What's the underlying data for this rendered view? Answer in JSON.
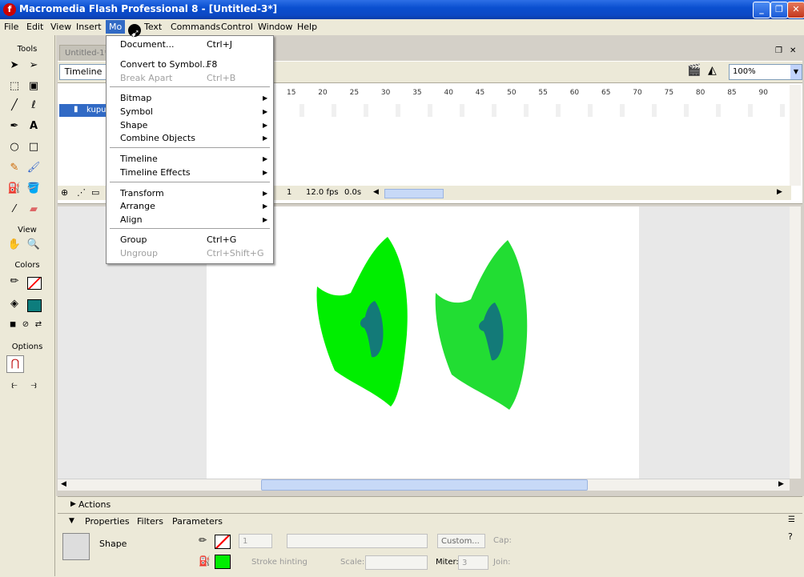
{
  "window": {
    "title": "Macromedia Flash Professional 8 - [Untitled-3*]",
    "app_icon": "flash-app-icon",
    "minimize": "_",
    "maximize": "❐",
    "close": "✕"
  },
  "menubar": {
    "items": [
      "File",
      "Edit",
      "View",
      "Insert",
      "Modify",
      "Text",
      "Commands",
      "Control",
      "Window",
      "Help"
    ],
    "active_label": "Mo"
  },
  "tools": {
    "title": "Tools",
    "view_label": "View",
    "colors_label": "Colors",
    "options_label": "Options",
    "fill_color": "#0d7d7d",
    "stroke_color": "none"
  },
  "document": {
    "tab_label": "Untitled-1*",
    "timeline_button": "Timeline",
    "zoom": "100%"
  },
  "timeline": {
    "ruler": [
      "15",
      "20",
      "25",
      "30",
      "35",
      "40",
      "45",
      "50",
      "55",
      "60",
      "65",
      "70",
      "75",
      "80",
      "85",
      "90"
    ],
    "layer_name": "kupu",
    "current_frame": "1",
    "fps": "12.0 fps",
    "time": "0.0s"
  },
  "modify_menu": {
    "items": [
      {
        "label": "Document...",
        "shortcut": "Ctrl+J",
        "disabled": false,
        "submenu": false
      },
      {
        "label": "Convert to Symbol...",
        "shortcut": "F8",
        "disabled": false,
        "submenu": false
      },
      {
        "label": "Break Apart",
        "shortcut": "Ctrl+B",
        "disabled": true,
        "submenu": false
      },
      {
        "label": "Bitmap",
        "shortcut": "",
        "disabled": false,
        "submenu": true
      },
      {
        "label": "Symbol",
        "shortcut": "",
        "disabled": false,
        "submenu": true
      },
      {
        "label": "Shape",
        "shortcut": "",
        "disabled": false,
        "submenu": true
      },
      {
        "label": "Combine Objects",
        "shortcut": "",
        "disabled": false,
        "submenu": true
      },
      {
        "label": "Timeline",
        "shortcut": "",
        "disabled": false,
        "submenu": true
      },
      {
        "label": "Timeline Effects",
        "shortcut": "",
        "disabled": false,
        "submenu": true
      },
      {
        "label": "Transform",
        "shortcut": "",
        "disabled": false,
        "submenu": true
      },
      {
        "label": "Arrange",
        "shortcut": "",
        "disabled": false,
        "submenu": true
      },
      {
        "label": "Align",
        "shortcut": "",
        "disabled": false,
        "submenu": true
      },
      {
        "label": "Group",
        "shortcut": "Ctrl+G",
        "disabled": false,
        "submenu": false
      },
      {
        "label": "Ungroup",
        "shortcut": "Ctrl+Shift+G",
        "disabled": true,
        "submenu": false
      }
    ]
  },
  "stage": {
    "shape_fill": "#00ee00",
    "shape_fill_2": "#22dd33",
    "inner_fill": "#137a78"
  },
  "panels": {
    "actions_label": "Actions",
    "tabs": [
      "Properties",
      "Filters",
      "Parameters"
    ],
    "selection_type": "Shape",
    "stroke_weight": "1",
    "stroke_hinting": "Stroke hinting",
    "scale_label": "Scale:",
    "custom_button": "Custom...",
    "cap_label": "Cap:",
    "miter_label": "Miter:",
    "miter_value": "3",
    "join_label": "Join:",
    "fill_swatch": "#00ee00"
  }
}
